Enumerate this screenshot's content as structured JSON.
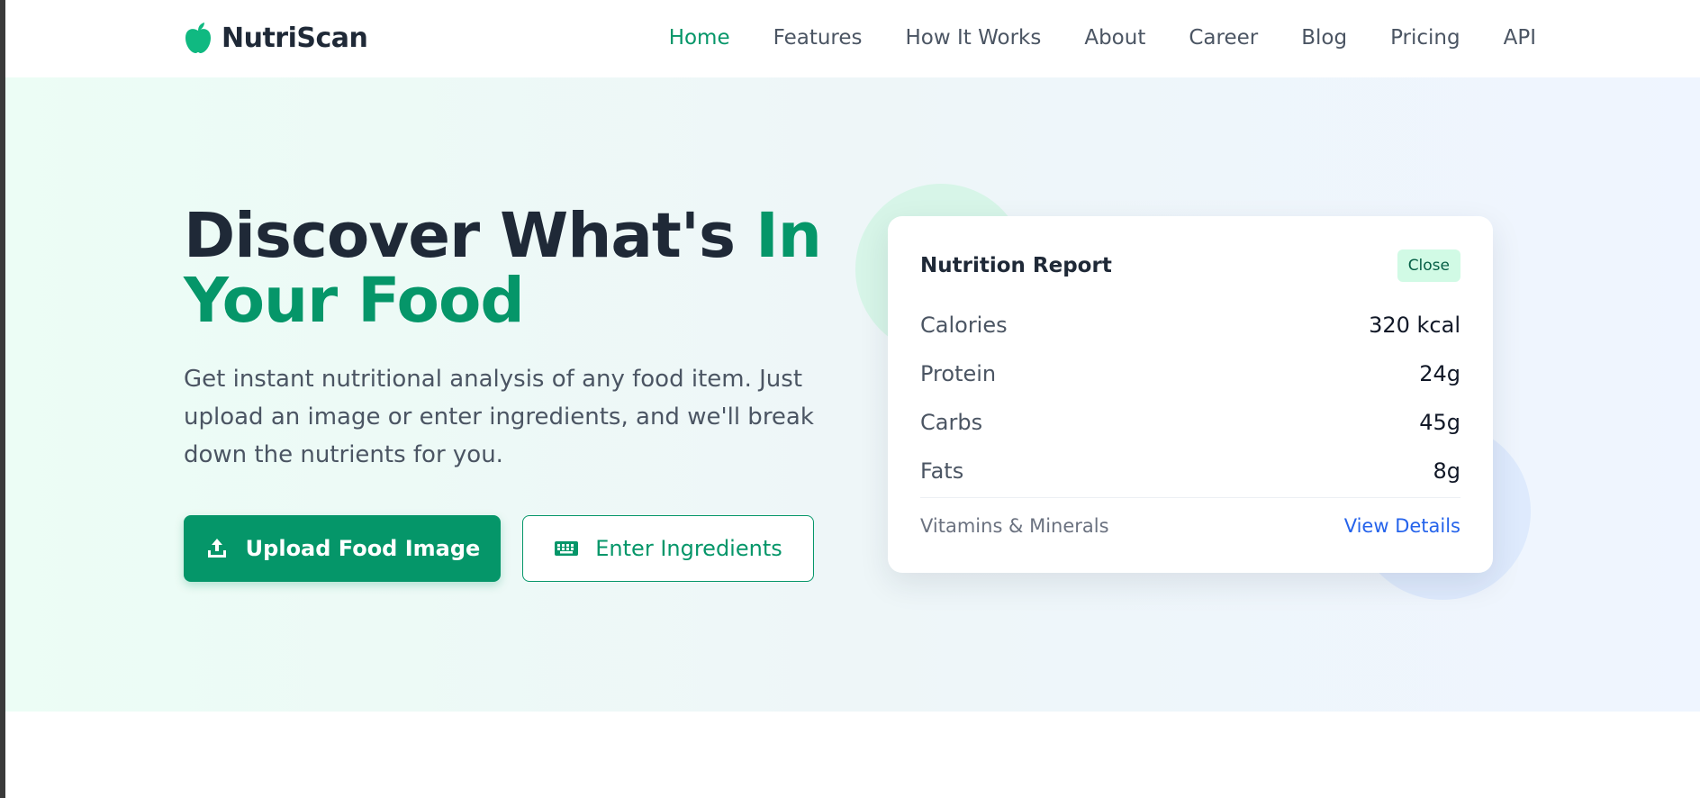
{
  "brand": {
    "name": "NutriScan",
    "icon": "apple-icon",
    "color": "#10b981"
  },
  "nav": {
    "items": [
      {
        "label": "Home",
        "active": true
      },
      {
        "label": "Features",
        "active": false
      },
      {
        "label": "How It Works",
        "active": false
      },
      {
        "label": "About",
        "active": false
      },
      {
        "label": "Career",
        "active": false
      },
      {
        "label": "Blog",
        "active": false
      },
      {
        "label": "Pricing",
        "active": false
      },
      {
        "label": "API",
        "active": false
      }
    ]
  },
  "hero": {
    "title_main": "Discover What's ",
    "title_accent_1": "In",
    "title_accent_2": "Your Food",
    "description": "Get instant nutritional analysis of any food item. Just upload an image or enter ingredients, and we'll break down the nutrients for you.",
    "primary_button": {
      "label": "Upload Food Image",
      "icon": "upload-icon"
    },
    "secondary_button": {
      "label": "Enter Ingredients",
      "icon": "keyboard-icon"
    }
  },
  "report": {
    "title": "Nutrition Report",
    "close_label": "Close",
    "rows": [
      {
        "label": "Calories",
        "value": "320 kcal"
      },
      {
        "label": "Protein",
        "value": "24g"
      },
      {
        "label": "Carbs",
        "value": "45g"
      },
      {
        "label": "Fats",
        "value": "8g"
      }
    ],
    "footer_label": "Vitamins & Minerals",
    "footer_link": "View Details"
  },
  "colors": {
    "accent": "#059669",
    "text_dark": "#1f2937",
    "link_blue": "#2563eb"
  }
}
